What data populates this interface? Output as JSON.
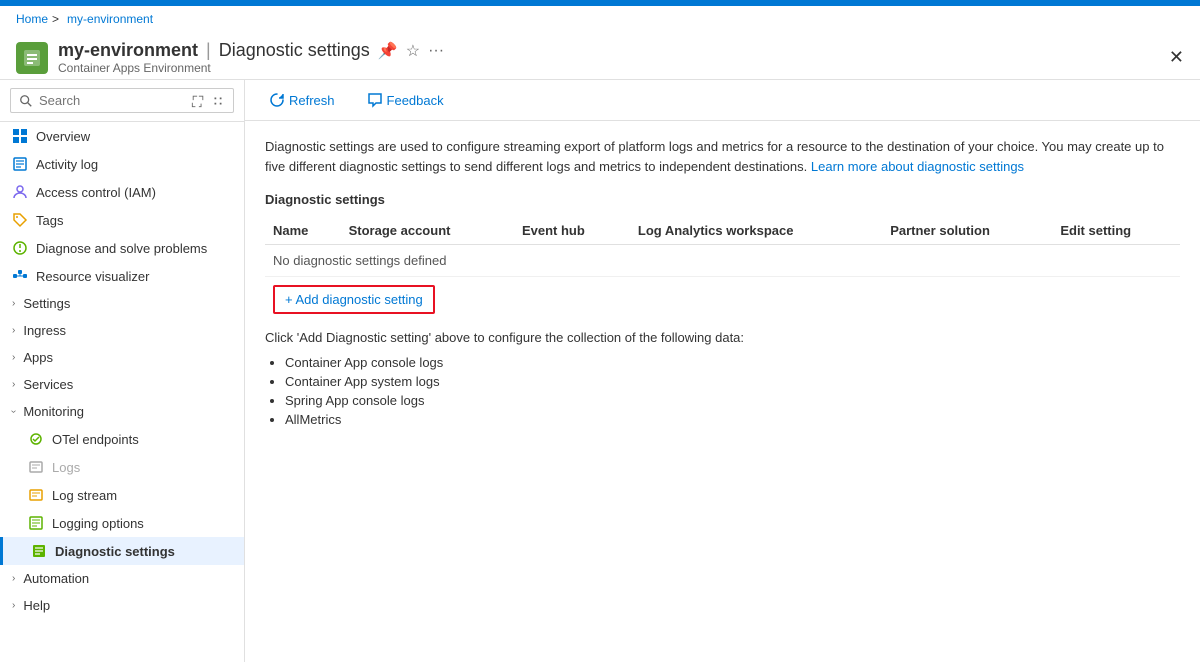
{
  "topbar": {
    "color": "#0078d4"
  },
  "breadcrumb": {
    "home": "Home",
    "separator": ">",
    "current": "my-environment"
  },
  "header": {
    "title": "my-environment",
    "divider": "|",
    "page": "Diagnostic settings",
    "subtitle": "Container Apps Environment",
    "pin_icon": "📌",
    "star_icon": "☆",
    "more_icon": "···",
    "close_icon": "✕"
  },
  "sidebar": {
    "search_placeholder": "Search",
    "items": [
      {
        "id": "overview",
        "label": "Overview",
        "icon": "overview",
        "active": false
      },
      {
        "id": "activity-log",
        "label": "Activity log",
        "icon": "activity",
        "active": false
      },
      {
        "id": "access-control",
        "label": "Access control (IAM)",
        "icon": "iam",
        "active": false
      },
      {
        "id": "tags",
        "label": "Tags",
        "icon": "tags",
        "active": false
      },
      {
        "id": "diagnose",
        "label": "Diagnose and solve problems",
        "icon": "diagnose",
        "active": false
      },
      {
        "id": "resource-viz",
        "label": "Resource visualizer",
        "icon": "visualizer",
        "active": false
      }
    ],
    "groups": [
      {
        "id": "settings",
        "label": "Settings",
        "expanded": false
      },
      {
        "id": "ingress",
        "label": "Ingress",
        "expanded": false
      },
      {
        "id": "apps",
        "label": "Apps",
        "expanded": false
      },
      {
        "id": "services",
        "label": "Services",
        "expanded": false
      }
    ],
    "monitoring": {
      "label": "Monitoring",
      "expanded": true,
      "subitems": [
        {
          "id": "otel",
          "label": "OTel endpoints",
          "icon": "otel",
          "active": false
        },
        {
          "id": "logs",
          "label": "Logs",
          "icon": "logs",
          "active": false,
          "disabled": true
        },
        {
          "id": "log-stream",
          "label": "Log stream",
          "icon": "logstream",
          "active": false
        },
        {
          "id": "logging-options",
          "label": "Logging options",
          "icon": "loggingoptions",
          "active": false
        },
        {
          "id": "diagnostic-settings",
          "label": "Diagnostic settings",
          "icon": "diagnostics",
          "active": true
        }
      ]
    },
    "bottom_groups": [
      {
        "id": "automation",
        "label": "Automation",
        "expanded": false
      },
      {
        "id": "help",
        "label": "Help",
        "expanded": false
      }
    ]
  },
  "toolbar": {
    "refresh_label": "Refresh",
    "feedback_label": "Feedback"
  },
  "content": {
    "description": "Diagnostic settings are used to configure streaming export of platform logs and metrics for a resource to the destination of your choice. You may create up to five different diagnostic settings to send different logs and metrics to independent destinations.",
    "learn_more_text": "Learn more about diagnostic settings",
    "section_title": "Diagnostic settings",
    "table_headers": {
      "name": "Name",
      "storage_account": "Storage account",
      "event_hub": "Event hub",
      "log_analytics": "Log Analytics workspace",
      "partner_solution": "Partner solution",
      "edit_setting": "Edit setting"
    },
    "no_settings_message": "No diagnostic settings defined",
    "add_button_label": "+ Add diagnostic setting",
    "instruction": "Click 'Add Diagnostic setting' above to configure the collection of the following data:",
    "data_items": [
      "Container App console logs",
      "Container App system logs",
      "Spring App console logs",
      "AllMetrics"
    ]
  }
}
